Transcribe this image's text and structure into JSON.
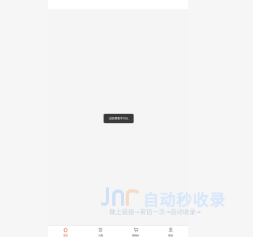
{
  "toast": {
    "text": "当前源暂不可以"
  },
  "watermark": {
    "title": "自动秒收录",
    "subtitle": "做上链接→来访一次→自动收录→"
  },
  "tabbar": {
    "items": [
      {
        "label": "首页",
        "icon": "home-icon",
        "active": true
      },
      {
        "label": "分类",
        "icon": "list-icon",
        "active": false
      },
      {
        "label": "购物车",
        "icon": "cart-icon",
        "active": false
      },
      {
        "label": "我的",
        "icon": "user-icon",
        "active": false
      }
    ]
  },
  "colors": {
    "accent": "#e05a2a",
    "toast_bg": "#3a3a3a",
    "watermark": "#d6e6fb"
  }
}
